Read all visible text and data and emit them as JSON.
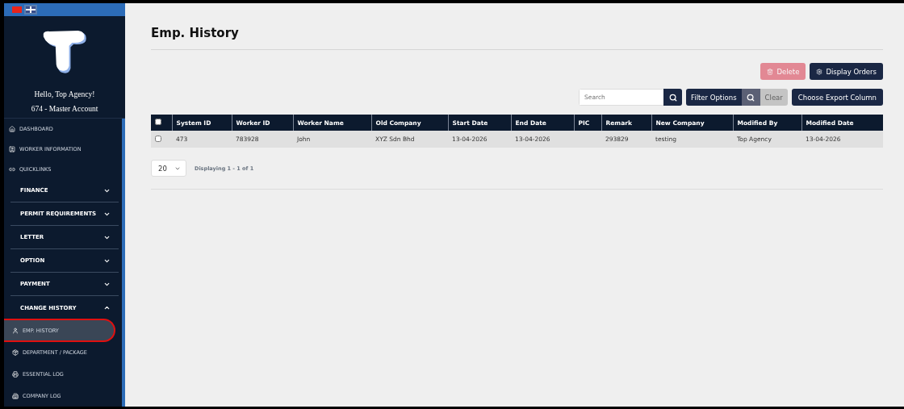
{
  "languages": [
    {
      "kind": "cn",
      "selected": false
    },
    {
      "kind": "uk",
      "selected": true
    }
  ],
  "greeting": "Hello, Top Agency!",
  "account": "674 - Master Account",
  "nav": [
    {
      "kind": "link",
      "label": "DASHBOARD"
    },
    {
      "kind": "link",
      "label": "WORKER INFORMATION"
    },
    {
      "kind": "link",
      "label": "QUICKLINKS"
    },
    {
      "kind": "group",
      "label": "FINANCE",
      "expanded": false
    },
    {
      "kind": "group",
      "label": "PERMIT REQUIREMENTS",
      "expanded": false
    },
    {
      "kind": "group",
      "label": "LETTER",
      "expanded": false
    },
    {
      "kind": "group",
      "label": "OPTION",
      "expanded": false
    },
    {
      "kind": "group",
      "label": "PAYMENT",
      "expanded": false
    },
    {
      "kind": "group",
      "label": "CHANGE HISTORY",
      "expanded": true,
      "children": [
        {
          "label": "EMP. HISTORY",
          "selected": true
        },
        {
          "label": "DEPARTMENT / PACKAGE",
          "selected": false
        },
        {
          "label": "ESSENTIAL LOG",
          "selected": false
        },
        {
          "label": "COMPANY LOG",
          "selected": false
        }
      ]
    }
  ],
  "page_title": "Emp. History",
  "actions": [
    {
      "kind": "delete",
      "label": "Delete",
      "disabled": true
    },
    {
      "kind": "settings",
      "label": "Display Orders",
      "disabled": false
    }
  ],
  "search": {
    "placeholder": "Search"
  },
  "filter": {
    "label": "Filter Options",
    "clear": "Clear",
    "clear_disabled": true
  },
  "export_button": "Choose Export Column",
  "table": {
    "columns": [
      "System ID",
      "Worker ID",
      "Worker Name",
      "Old Company",
      "Start Date",
      "End Date",
      "PIC",
      "Remark",
      "New Company",
      "Modified By",
      "Modified Date"
    ],
    "all_checked": false,
    "rows": [
      {
        "checked": false,
        "cells": [
          "473",
          "783928",
          "John",
          "XYZ Sdn Bhd",
          "13-04-2026",
          "13-04-2026",
          "",
          "293829",
          "testing",
          "Top Agency",
          "13-04-2026"
        ]
      }
    ]
  },
  "page_size": "20",
  "pagination_info": "Displaying 1 - 1 of 1"
}
